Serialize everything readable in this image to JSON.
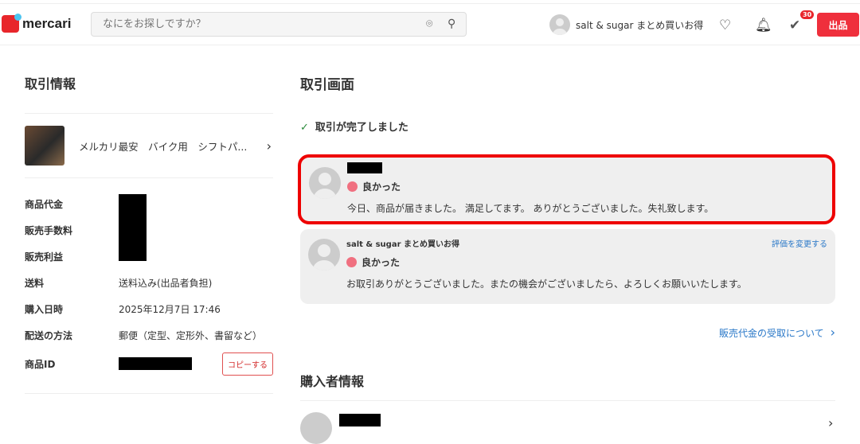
{
  "header": {
    "logo": "mercari",
    "search_placeholder": "なにをお探しですか？",
    "username": "salt & sugar まとめ買いお得",
    "todo_count": "30",
    "sell_label": "出品"
  },
  "left": {
    "title": "取引情報",
    "item_name": "メルカリ最安　バイク用　シフトパ...",
    "rows": [
      {
        "label": "商品代金"
      },
      {
        "label": "販売手数料"
      },
      {
        "label": "販売利益"
      },
      {
        "label": "送料",
        "value": "送料込み(出品者負担)"
      },
      {
        "label": "購入日時",
        "value": "2025年12月7日 17:46"
      },
      {
        "label": "配送の方法",
        "value": "郵便（定型、定形外、書留など）"
      },
      {
        "label": "商品ID"
      }
    ],
    "copy_label": "コピーする"
  },
  "right": {
    "title": "取引画面",
    "status": "取引が完了しました",
    "reviews": [
      {
        "rating": "良かった",
        "comment": "今日、商品が届きました。 満足してます。 ありがとうございました。失礼致します。"
      },
      {
        "name": "salt & sugar まとめ買いお得",
        "rating": "良かった",
        "comment": "お取引ありがとうございました。またの機会がございましたら、よろしくお願いいたします。",
        "change_label": "評価を変更する"
      }
    ],
    "payout_link": "販売代金の受取について",
    "buyer_title": "購入者情報"
  }
}
